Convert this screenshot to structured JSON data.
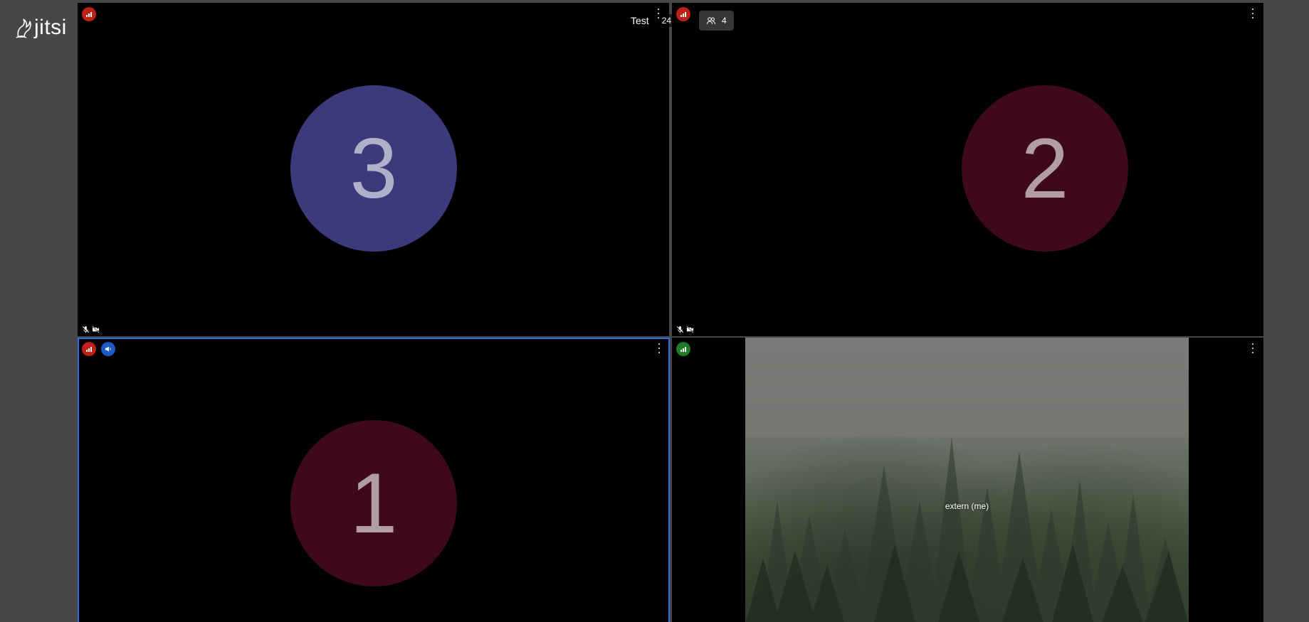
{
  "app": {
    "logo_text": "jitsi"
  },
  "conference": {
    "subject": "Test",
    "timer": "24",
    "participant_count": "4"
  },
  "tiles": [
    {
      "avatar_initial": "3",
      "avatar_color": "#3c3a7a",
      "connection_color": "#bf2117",
      "tile_id": "participant-3"
    },
    {
      "avatar_initial": "2",
      "avatar_color": "#3e0a1b",
      "connection_color": "#bf2117",
      "tile_id": "participant-2"
    },
    {
      "avatar_initial": "1",
      "avatar_color": "#3e0a1b",
      "connection_color": "#bf2117",
      "dominant_speaker": true,
      "tile_id": "participant-1"
    },
    {
      "display_name": "extern (me)",
      "connection_color": "#1e7c2a",
      "tile_id": "local"
    }
  ],
  "colors": {
    "background": "#474747",
    "active_speaker_border": "#246fe5",
    "raised_hand_badge": "#1f5bc6"
  },
  "icons": {
    "connection": "signal-bars-icon",
    "menu": "more-vertical-icon",
    "muted": "mic-off-icon",
    "video_off": "camera-off-icon",
    "participants": "people-icon",
    "raised_hand": "raised-hand-icon"
  }
}
